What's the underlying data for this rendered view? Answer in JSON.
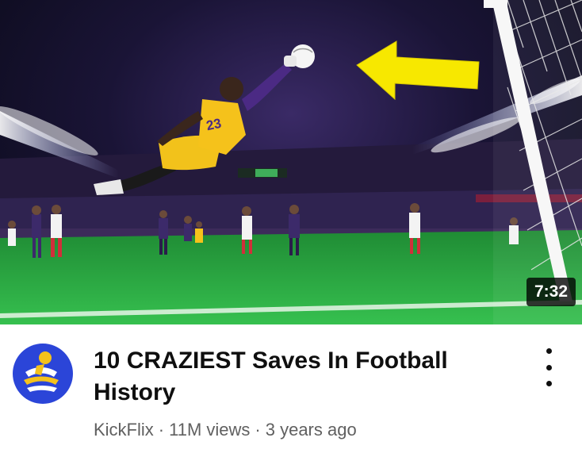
{
  "video": {
    "duration": "7:32",
    "jersey_number": "23",
    "title": "10 CRAZIEST Saves In Football History",
    "channel": "KickFlix",
    "views": "11M views",
    "age": "3 years ago",
    "separator": "·"
  },
  "icons": {
    "more": "kebab-vertical-icon",
    "channel_avatar": "kickflix-logo"
  },
  "colors": {
    "arrow": "#f7e800",
    "jersey": "#f5c21b",
    "avatar_bg": "#2b45d8",
    "pitch": "#27a844"
  }
}
